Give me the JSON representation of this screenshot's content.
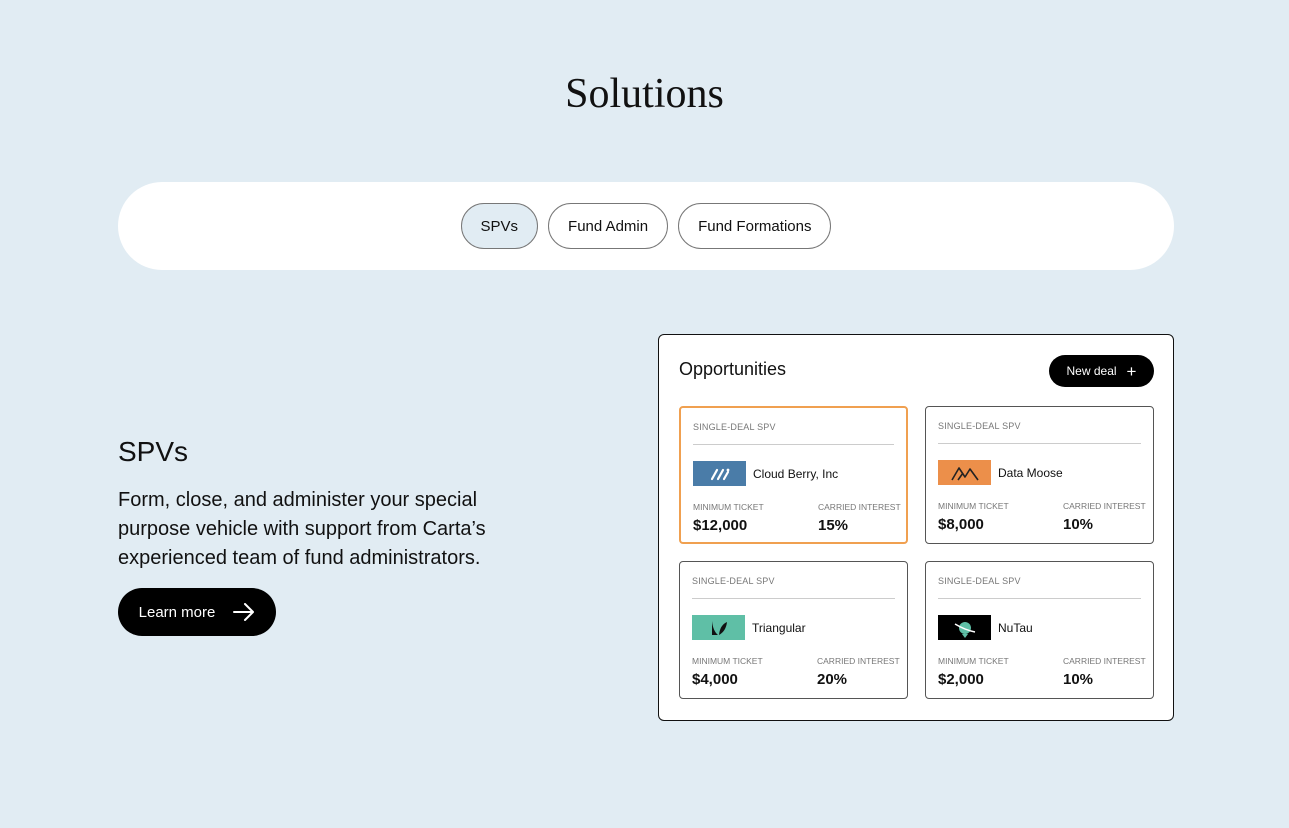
{
  "page": {
    "title": "Solutions",
    "tabs": [
      {
        "label": "SPVs",
        "active": true
      },
      {
        "label": "Fund Admin",
        "active": false
      },
      {
        "label": "Fund Formations",
        "active": false
      }
    ]
  },
  "spv_section": {
    "heading": "SPVs",
    "description": "Form, close, and administer your special purpose vehicle with support from Carta’s experienced team of fund administrators.",
    "cta_label": "Learn more"
  },
  "opportunities": {
    "title": "Opportunities",
    "new_deal_label": "New deal",
    "cards": [
      {
        "kind": "SINGLE-DEAL SPV",
        "company": "Cloud Berry, Inc",
        "min_ticket_label": "MINIMUM TICKET",
        "min_ticket": "$12,000",
        "carry_label": "CARRIED INTEREST",
        "carry": "15%",
        "logo_color": "#4a7ca8",
        "selected": true
      },
      {
        "kind": "SINGLE-DEAL SPV",
        "company": "Data Moose",
        "min_ticket_label": "MINIMUM TICKET",
        "min_ticket": "$8,000",
        "carry_label": "CARRIED INTEREST",
        "carry": "10%",
        "logo_color": "#ec8f4a",
        "selected": false
      },
      {
        "kind": "SINGLE-DEAL SPV",
        "company": "Triangular",
        "min_ticket_label": "MINIMUM TICKET",
        "min_ticket": "$4,000",
        "carry_label": "CARRIED INTEREST",
        "carry": "20%",
        "logo_color": "#5fbfa6",
        "selected": false
      },
      {
        "kind": "SINGLE-DEAL SPV",
        "company": "NuTau",
        "min_ticket_label": "MINIMUM TICKET",
        "min_ticket": "$2,000",
        "carry_label": "CARRIED INTEREST",
        "carry": "10%",
        "logo_color": "#000000",
        "selected": false
      }
    ]
  },
  "colors": {
    "background": "#e1ecf3",
    "selected_border": "#f0a050",
    "button_bg": "#000000"
  }
}
